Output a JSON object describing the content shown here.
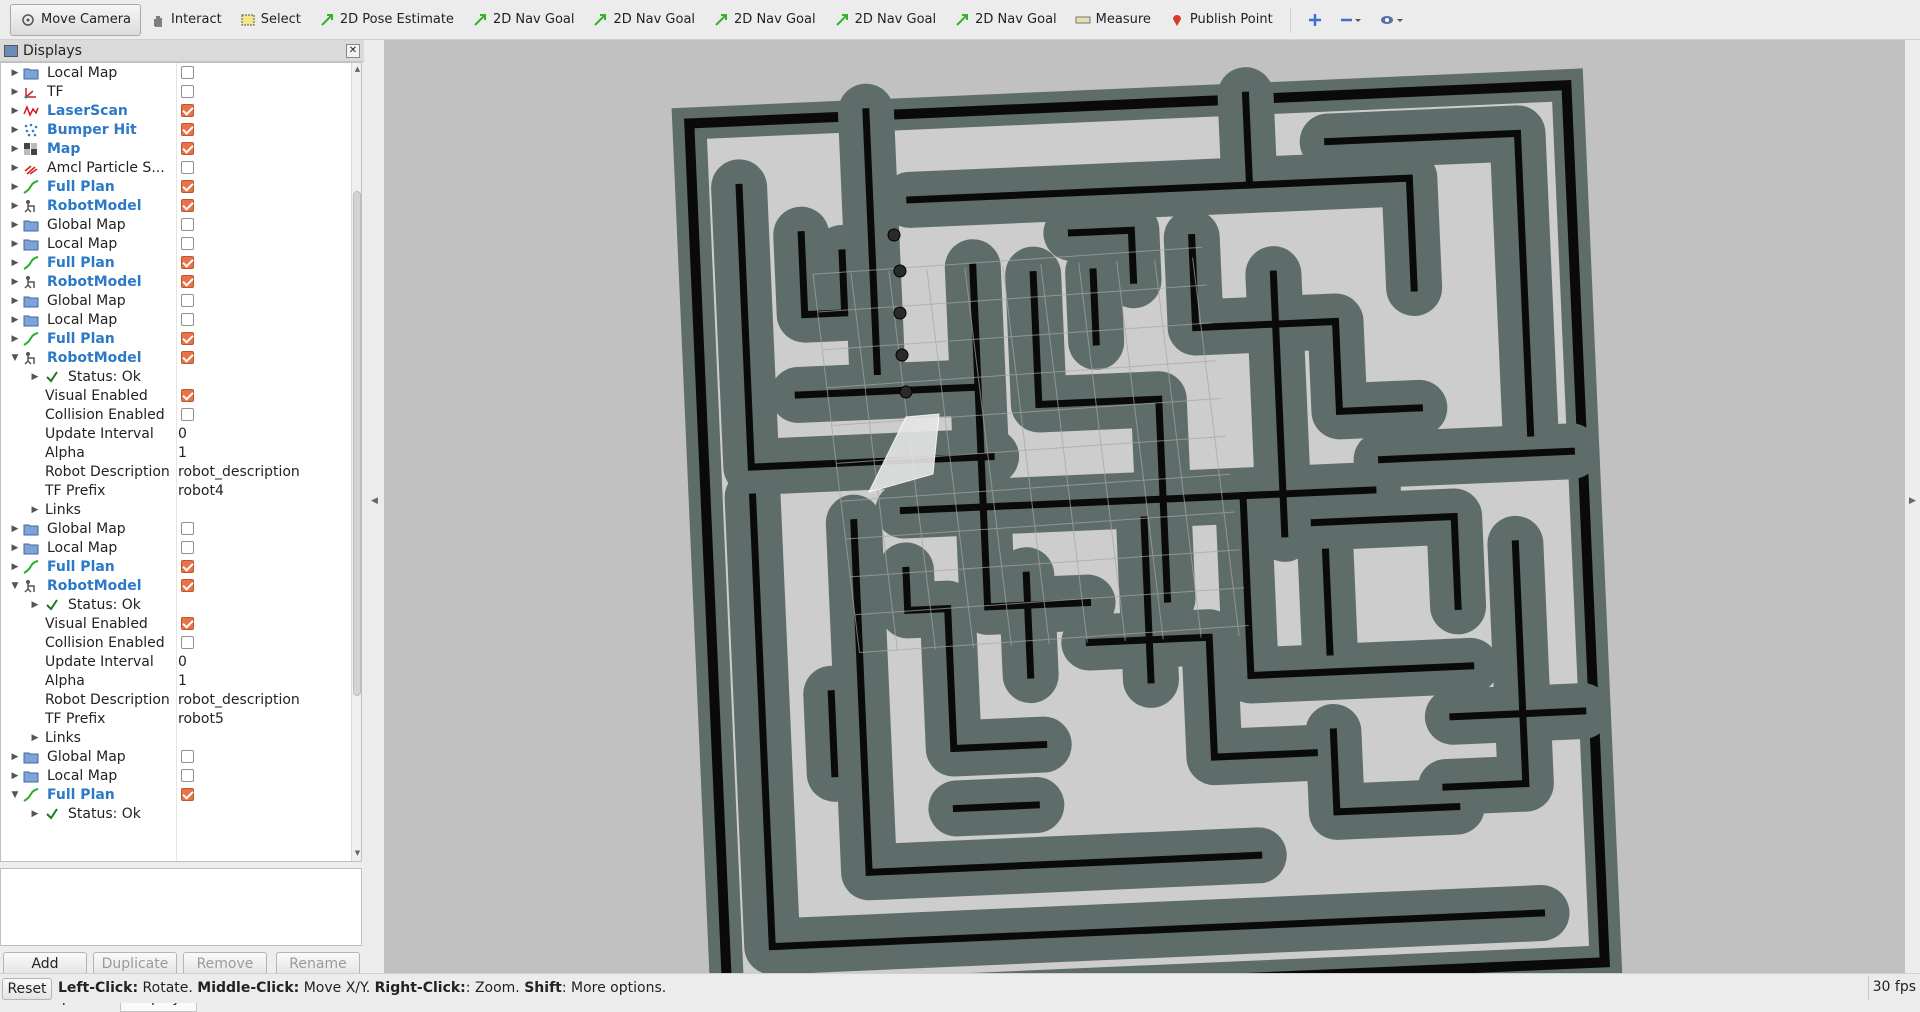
{
  "toolbar": {
    "items": [
      {
        "label": "Move Camera",
        "icon": "move-camera-icon",
        "active": true
      },
      {
        "label": "Interact",
        "icon": "hand-icon"
      },
      {
        "label": "Select",
        "icon": "select-box-icon"
      },
      {
        "label": "2D Pose Estimate",
        "icon": "green-arrow-icon"
      },
      {
        "label": "2D Nav Goal",
        "icon": "green-arrow-icon"
      },
      {
        "label": "2D Nav Goal",
        "icon": "green-arrow-icon"
      },
      {
        "label": "2D Nav Goal",
        "icon": "green-arrow-icon"
      },
      {
        "label": "2D Nav Goal",
        "icon": "green-arrow-icon"
      },
      {
        "label": "2D Nav Goal",
        "icon": "green-arrow-icon"
      },
      {
        "label": "Measure",
        "icon": "ruler-icon"
      },
      {
        "label": "Publish Point",
        "icon": "map-pin-icon"
      }
    ]
  },
  "displays_panel": {
    "title": "Displays",
    "rows": [
      {
        "label": "Local Map",
        "icon": "folder",
        "arrow": "right",
        "checkbox": false,
        "indent": 0
      },
      {
        "label": "TF",
        "icon": "tf",
        "arrow": "right",
        "checkbox": false,
        "indent": 0
      },
      {
        "label": "LaserScan",
        "icon": "laser",
        "arrow": "right",
        "checkbox": true,
        "bold": true,
        "indent": 0
      },
      {
        "label": "Bumper Hit",
        "icon": "points",
        "arrow": "right",
        "checkbox": true,
        "bold": true,
        "indent": 0
      },
      {
        "label": "Map",
        "icon": "map",
        "arrow": "right",
        "checkbox": true,
        "bold": true,
        "indent": 0
      },
      {
        "label": "Amcl Particle S...",
        "icon": "particles",
        "arrow": "right",
        "checkbox": false,
        "indent": 0
      },
      {
        "label": "Full Plan",
        "icon": "path",
        "arrow": "right",
        "checkbox": true,
        "bold": true,
        "indent": 0
      },
      {
        "label": "RobotModel",
        "icon": "robot",
        "arrow": "right",
        "checkbox": true,
        "bold": true,
        "indent": 0
      },
      {
        "label": "Global Map",
        "icon": "folder",
        "arrow": "right",
        "checkbox": false,
        "indent": 0
      },
      {
        "label": "Local Map",
        "icon": "folder",
        "arrow": "right",
        "checkbox": false,
        "indent": 0
      },
      {
        "label": "Full Plan",
        "icon": "path",
        "arrow": "right",
        "checkbox": true,
        "bold": true,
        "indent": 0
      },
      {
        "label": "RobotModel",
        "icon": "robot",
        "arrow": "right",
        "checkbox": true,
        "bold": true,
        "indent": 0
      },
      {
        "label": "Global Map",
        "icon": "folder",
        "arrow": "right",
        "checkbox": false,
        "indent": 0
      },
      {
        "label": "Local Map",
        "icon": "folder",
        "arrow": "right",
        "checkbox": false,
        "indent": 0
      },
      {
        "label": "Full Plan",
        "icon": "path",
        "arrow": "right",
        "checkbox": true,
        "bold": true,
        "indent": 0
      },
      {
        "label": "RobotModel",
        "icon": "robot",
        "arrow": "down",
        "checkbox": true,
        "bold": true,
        "indent": 0
      },
      {
        "label": "Status: Ok",
        "icon": "check",
        "arrow": "right",
        "indent": 1
      },
      {
        "label": "Visual Enabled",
        "checkbox": true,
        "indent": 2
      },
      {
        "label": "Collision Enabled",
        "checkbox": false,
        "indent": 2
      },
      {
        "label": "Update Interval",
        "value": "0",
        "indent": 2
      },
      {
        "label": "Alpha",
        "value": "1",
        "indent": 2
      },
      {
        "label": "Robot Description",
        "value": "robot_description",
        "indent": 2
      },
      {
        "label": "TF Prefix",
        "value": "robot4",
        "indent": 2
      },
      {
        "label": "Links",
        "arrow": "right",
        "indent": 1
      },
      {
        "label": "Global Map",
        "icon": "folder",
        "arrow": "right",
        "checkbox": false,
        "indent": 0
      },
      {
        "label": "Local Map",
        "icon": "folder",
        "arrow": "right",
        "checkbox": false,
        "indent": 0
      },
      {
        "label": "Full Plan",
        "icon": "path",
        "arrow": "right",
        "checkbox": true,
        "bold": true,
        "indent": 0
      },
      {
        "label": "RobotModel",
        "icon": "robot",
        "arrow": "down",
        "checkbox": true,
        "bold": true,
        "indent": 0
      },
      {
        "label": "Status: Ok",
        "icon": "check",
        "arrow": "right",
        "indent": 1
      },
      {
        "label": "Visual Enabled",
        "checkbox": true,
        "indent": 2
      },
      {
        "label": "Collision Enabled",
        "checkbox": false,
        "indent": 2
      },
      {
        "label": "Update Interval",
        "value": "0",
        "indent": 2
      },
      {
        "label": "Alpha",
        "value": "1",
        "indent": 2
      },
      {
        "label": "Robot Description",
        "value": "robot_description",
        "indent": 2
      },
      {
        "label": "TF Prefix",
        "value": "robot5",
        "indent": 2
      },
      {
        "label": "Links",
        "arrow": "right",
        "indent": 1
      },
      {
        "label": "Global Map",
        "icon": "folder",
        "arrow": "right",
        "checkbox": false,
        "indent": 0
      },
      {
        "label": "Local Map",
        "icon": "folder",
        "arrow": "right",
        "checkbox": false,
        "indent": 0
      },
      {
        "label": "Full Plan",
        "icon": "path",
        "arrow": "down",
        "checkbox": true,
        "bold": true,
        "indent": 0
      },
      {
        "label": "Status: Ok",
        "icon": "check",
        "arrow": "right",
        "indent": 1
      }
    ],
    "buttons": {
      "add": "Add",
      "duplicate": "Duplicate",
      "remove": "Remove",
      "rename": "Rename"
    },
    "tabs": {
      "tool_properties": "Tool Properties",
      "displays": "Displays"
    }
  },
  "status_bar": {
    "reset": "Reset",
    "hint_parts": [
      {
        "text": "Left-Click:",
        "bold": true
      },
      {
        "text": " Rotate. ",
        "bold": false
      },
      {
        "text": "Middle-Click:",
        "bold": true
      },
      {
        "text": " Move X/Y. ",
        "bold": false
      },
      {
        "text": "Right-Click:",
        "bold": true
      },
      {
        "text": ": Zoom. ",
        "bold": false
      },
      {
        "text": "Shift",
        "bold": true
      },
      {
        "text": ": More options.",
        "bold": false
      }
    ],
    "fps": "30 fps"
  },
  "colors": {
    "accent_blue": "#2b79c7",
    "checkbox_on": "#e8734a",
    "map_background": "#c1c1c1",
    "map_free": "#cdcdcd",
    "map_inflation": "#5f6d6a",
    "map_wall": "#0a0a0a"
  }
}
